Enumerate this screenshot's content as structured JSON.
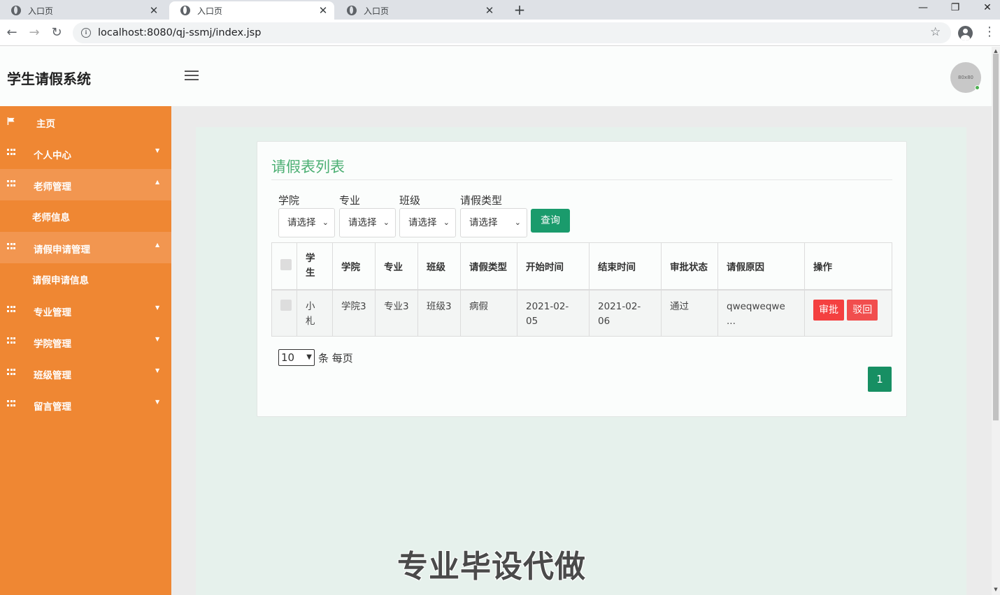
{
  "browser": {
    "tabs": [
      {
        "title": "入口页"
      },
      {
        "title": "入口页"
      },
      {
        "title": "入口页"
      }
    ],
    "url": "localhost:8080/qj-ssmj/index.jsp"
  },
  "header": {
    "brand": "学生请假系统",
    "avatar_text": "80x80"
  },
  "sidebar": {
    "items": [
      {
        "label": "主页",
        "icon": "flag-icon"
      },
      {
        "label": "个人中心",
        "icon": "grid-icon"
      },
      {
        "label": "老师管理",
        "icon": "grid-icon",
        "expanded": true
      },
      {
        "label": "请假申请管理",
        "icon": "grid-icon",
        "expanded": true
      },
      {
        "label": "专业管理",
        "icon": "grid-icon"
      },
      {
        "label": "学院管理",
        "icon": "grid-icon"
      },
      {
        "label": "班级管理",
        "icon": "grid-icon"
      },
      {
        "label": "留言管理",
        "icon": "grid-icon"
      }
    ],
    "subitems": {
      "teacher": "老师信息",
      "leave": "请假申请信息"
    }
  },
  "main": {
    "title": "请假表列表",
    "filters": [
      {
        "label": "学院",
        "value": "请选择"
      },
      {
        "label": "专业",
        "value": "请选择"
      },
      {
        "label": "班级",
        "value": "请选择"
      },
      {
        "label": "请假类型",
        "value": "请选择"
      }
    ],
    "query_button": "查询",
    "table": {
      "headers": [
        "学生",
        "学院",
        "专业",
        "班级",
        "请假类型",
        "开始时间",
        "结束时间",
        "审批状态",
        "请假原因",
        "操作"
      ],
      "rows": [
        {
          "student": "小札",
          "college": "学院3",
          "major": "专业3",
          "class": "班级3",
          "leave_type": "病假",
          "start": "2021-02-05",
          "end": "2021-02-06",
          "status": "通过",
          "reason": "qweqweqwe ...",
          "approve_label": "审批",
          "reject_label": "驳回"
        }
      ]
    },
    "pagination": {
      "page_size": "10",
      "page_size_label": "条 每页",
      "current_page": "1"
    }
  },
  "watermark": "专业毕设代做",
  "colors": {
    "sidebar": "#ef8733",
    "accent_green": "#1a9b6c",
    "title_green": "#4caf73",
    "danger": "#f44040"
  }
}
